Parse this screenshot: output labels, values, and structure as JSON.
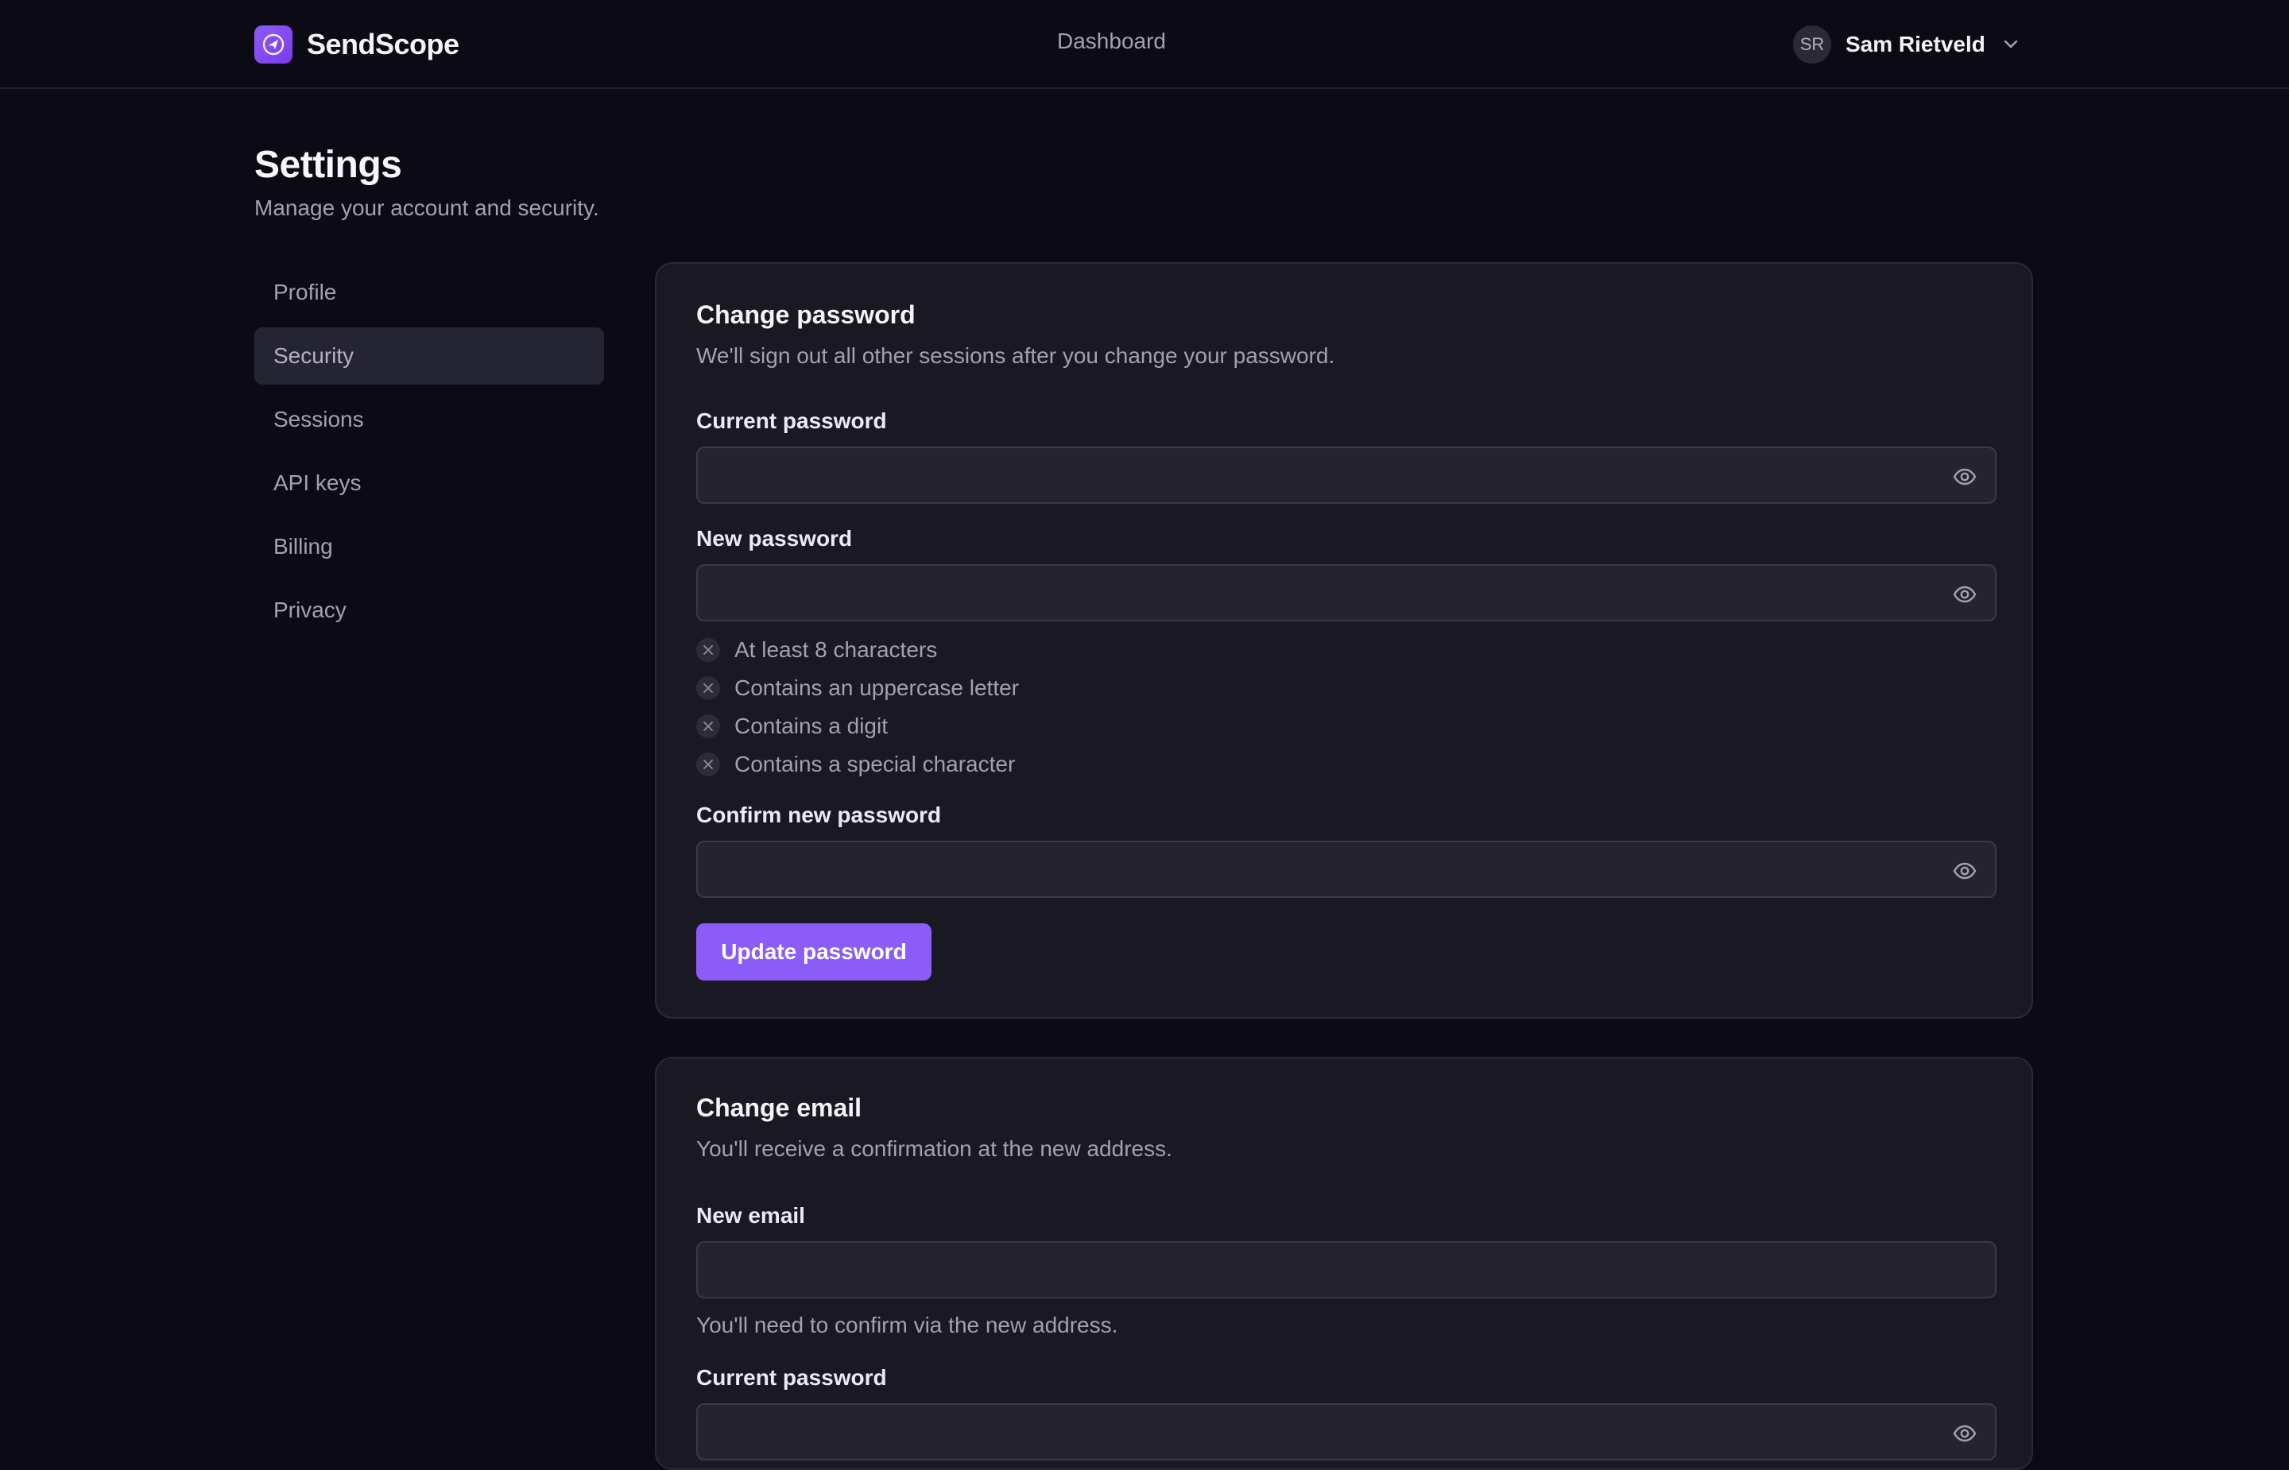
{
  "app": {
    "name": "SendScope"
  },
  "header": {
    "nav_link": "Dashboard",
    "user": {
      "initials": "SR",
      "name": "Sam Rietveld"
    }
  },
  "page": {
    "title": "Settings",
    "subtitle": "Manage your account and security."
  },
  "sidebar": {
    "items": [
      {
        "label": "Profile",
        "active": false
      },
      {
        "label": "Security",
        "active": true
      },
      {
        "label": "Sessions",
        "active": false
      },
      {
        "label": "API keys",
        "active": false
      },
      {
        "label": "Billing",
        "active": false
      },
      {
        "label": "Privacy",
        "active": false
      }
    ]
  },
  "change_password": {
    "title": "Change password",
    "description": "We'll sign out all other sessions after you change your password.",
    "current_label": "Current password",
    "current_value": "",
    "new_label": "New password",
    "new_value": "",
    "requirements": [
      {
        "text": "At least 8 characters",
        "met": false
      },
      {
        "text": "Contains an uppercase letter",
        "met": false
      },
      {
        "text": "Contains a digit",
        "met": false
      },
      {
        "text": "Contains a special character",
        "met": false
      }
    ],
    "confirm_label": "Confirm new password",
    "confirm_value": "",
    "submit_label": "Update password"
  },
  "change_email": {
    "title": "Change email",
    "description": "You'll receive a confirmation at the new address.",
    "email_label": "New email",
    "email_value": "",
    "email_hint": "You'll need to confirm via the new address.",
    "current_label": "Current password",
    "current_value": ""
  },
  "colors": {
    "accent": "#8b5cf6",
    "background": "#0c0b15",
    "card": "#191823"
  },
  "icons": {
    "logo": "send-compass-icon",
    "password_toggle": "eye-icon",
    "requirement_unmet": "x-icon",
    "user_menu": "chevron-down-icon"
  }
}
